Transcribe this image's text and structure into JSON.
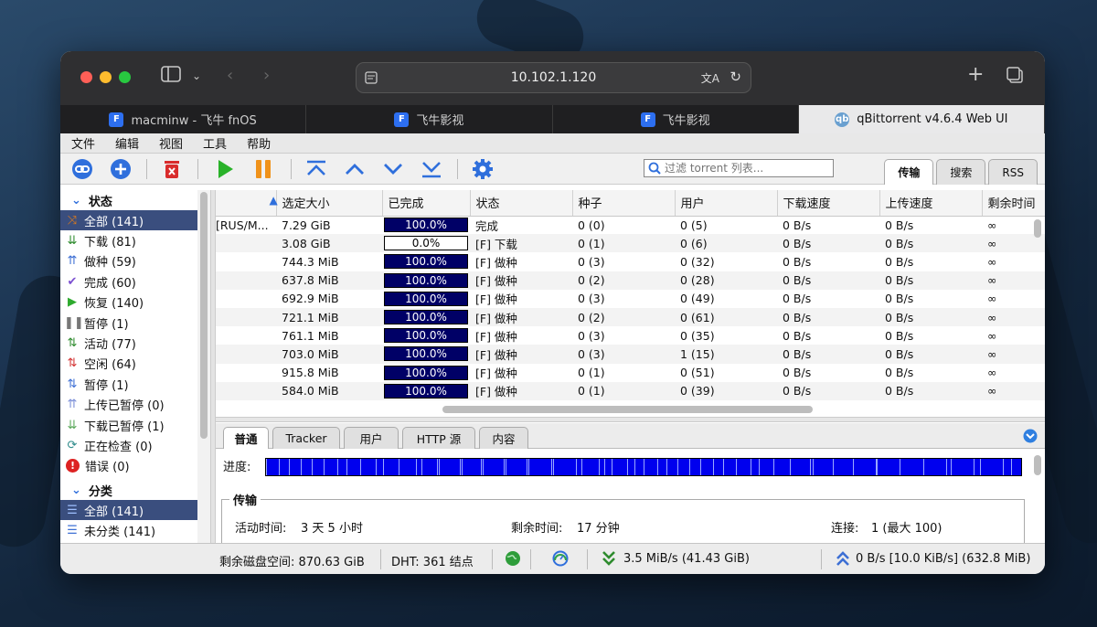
{
  "browser": {
    "url": "10.102.1.120",
    "tabs": [
      {
        "label": "macminw - 飞牛 fnOS",
        "icon": "fnos-icon",
        "active": false
      },
      {
        "label": "飞牛影视",
        "icon": "fn-video-icon",
        "active": false
      },
      {
        "label": "飞牛影视",
        "icon": "fn-video-icon",
        "active": false
      },
      {
        "label": "qBittorrent v4.6.4 Web UI",
        "icon": "qbittorrent-icon",
        "active": true
      }
    ]
  },
  "menu": [
    "文件",
    "编辑",
    "视图",
    "工具",
    "帮助"
  ],
  "search": {
    "placeholder": "过滤 torrent 列表..."
  },
  "right_tabs": [
    {
      "label": "传输",
      "active": true
    },
    {
      "label": "搜索",
      "active": false
    },
    {
      "label": "RSS",
      "active": false
    }
  ],
  "sidebar": {
    "status_title": "状态",
    "status_items": [
      {
        "label": "全部 (141)",
        "icon": "shuffle-icon",
        "color": "#e07b1a",
        "selected": true
      },
      {
        "label": "下载 (81)",
        "icon": "download-icon",
        "color": "#2e8b2e"
      },
      {
        "label": "做种 (59)",
        "icon": "upload-icon",
        "color": "#3d6fd4"
      },
      {
        "label": "完成 (60)",
        "icon": "check-icon",
        "color": "#7b4fd1"
      },
      {
        "label": "恢复 (140)",
        "icon": "play-icon",
        "color": "#2eaa2e"
      },
      {
        "label": "暂停 (1)",
        "icon": "pause-icon",
        "color": "#777777"
      },
      {
        "label": "活动 (77)",
        "icon": "active-arrows-icon",
        "color": "#2e8b2e"
      },
      {
        "label": "空闲 (64)",
        "icon": "inactive-arrows-icon",
        "color": "#d33333"
      },
      {
        "label": "暂停 (1)",
        "icon": "stalled-arrows-icon",
        "color": "#3d6fd4"
      },
      {
        "label": "上传已暂停 (0)",
        "icon": "upload-stalled-icon",
        "color": "#7b8fd8"
      },
      {
        "label": "下载已暂停 (1)",
        "icon": "download-stalled-icon",
        "color": "#5aa85a"
      },
      {
        "label": "正在检查 (0)",
        "icon": "checking-icon",
        "color": "#2e8b8b"
      },
      {
        "label": "错误 (0)",
        "icon": "error-icon",
        "color": "#dd2222"
      }
    ],
    "category_title": "分类",
    "category_items": [
      {
        "label": "全部 (141)",
        "icon": "list-icon",
        "color": "#3d6fd4",
        "selected": true
      },
      {
        "label": "未分类 (141)",
        "icon": "list-icon",
        "color": "#3d6fd4"
      }
    ]
  },
  "table": {
    "columns": [
      "",
      "选定大小",
      "已完成",
      "状态",
      "种子",
      "用户",
      "下载速度",
      "上传速度",
      "剩余时间"
    ],
    "rows": [
      {
        "name": "[RUS/M...",
        "size": "7.29 GiB",
        "progress": 100,
        "progress_label": "100.0%",
        "state": "完成",
        "seeds": "0 (0)",
        "peers": "0 (5)",
        "dl": "0 B/s",
        "ul": "0 B/s",
        "eta": "∞"
      },
      {
        "name": "",
        "size": "3.08 GiB",
        "progress": 0,
        "progress_label": "0.0%",
        "state": "[F] 下载",
        "seeds": "0 (1)",
        "peers": "0 (6)",
        "dl": "0 B/s",
        "ul": "0 B/s",
        "eta": "∞"
      },
      {
        "name": "",
        "size": "744.3 MiB",
        "progress": 100,
        "progress_label": "100.0%",
        "state": "[F] 做种",
        "seeds": "0 (3)",
        "peers": "0 (32)",
        "dl": "0 B/s",
        "ul": "0 B/s",
        "eta": "∞"
      },
      {
        "name": "",
        "size": "637.8 MiB",
        "progress": 100,
        "progress_label": "100.0%",
        "state": "[F] 做种",
        "seeds": "0 (2)",
        "peers": "0 (28)",
        "dl": "0 B/s",
        "ul": "0 B/s",
        "eta": "∞"
      },
      {
        "name": "",
        "size": "692.9 MiB",
        "progress": 100,
        "progress_label": "100.0%",
        "state": "[F] 做种",
        "seeds": "0 (3)",
        "peers": "0 (49)",
        "dl": "0 B/s",
        "ul": "0 B/s",
        "eta": "∞"
      },
      {
        "name": "",
        "size": "721.1 MiB",
        "progress": 100,
        "progress_label": "100.0%",
        "state": "[F] 做种",
        "seeds": "0 (2)",
        "peers": "0 (61)",
        "dl": "0 B/s",
        "ul": "0 B/s",
        "eta": "∞"
      },
      {
        "name": "",
        "size": "761.1 MiB",
        "progress": 100,
        "progress_label": "100.0%",
        "state": "[F] 做种",
        "seeds": "0 (3)",
        "peers": "0 (35)",
        "dl": "0 B/s",
        "ul": "0 B/s",
        "eta": "∞"
      },
      {
        "name": "",
        "size": "703.0 MiB",
        "progress": 100,
        "progress_label": "100.0%",
        "state": "[F] 做种",
        "seeds": "0 (3)",
        "peers": "1 (15)",
        "dl": "0 B/s",
        "ul": "0 B/s",
        "eta": "∞"
      },
      {
        "name": "",
        "size": "915.8 MiB",
        "progress": 100,
        "progress_label": "100.0%",
        "state": "[F] 做种",
        "seeds": "0 (1)",
        "peers": "0 (51)",
        "dl": "0 B/s",
        "ul": "0 B/s",
        "eta": "∞"
      },
      {
        "name": "",
        "size": "584.0 MiB",
        "progress": 100,
        "progress_label": "100.0%",
        "state": "[F] 做种",
        "seeds": "0 (1)",
        "peers": "0 (39)",
        "dl": "0 B/s",
        "ul": "0 B/s",
        "eta": "∞"
      }
    ]
  },
  "properties": {
    "tabs": [
      {
        "label": "普通",
        "active": true
      },
      {
        "label": "Tracker"
      },
      {
        "label": "用户"
      },
      {
        "label": "HTTP 源"
      },
      {
        "label": "内容"
      }
    ],
    "progress_label": "进度:",
    "transfer_title": "传输",
    "active_time_label": "活动时间:",
    "active_time_value": "3 天 5 小时",
    "eta_label": "剩余时间:",
    "eta_value": "17 分钟",
    "connections_label": "连接:",
    "connections_value": "1 (最大 100)"
  },
  "statusbar": {
    "free_space": "剩余磁盘空间: 870.63 GiB",
    "dht": "DHT: 361 结点",
    "download": "3.5 MiB/s (41.43 GiB)",
    "upload": "0 B/s [10.0 KiB/s] (632.8 MiB)"
  }
}
